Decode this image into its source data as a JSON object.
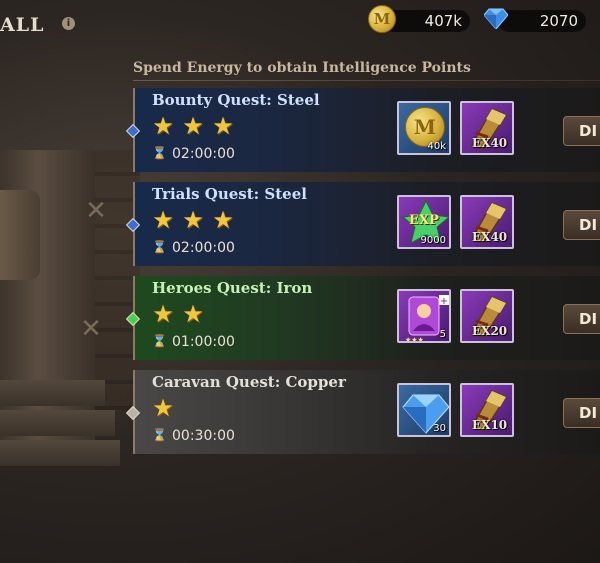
{
  "header": {
    "title": "ALL",
    "info_icon": "i",
    "resources": [
      {
        "name": "gold",
        "icon": "gold-coin-icon",
        "icon_glyph": "M",
        "value": "407k"
      },
      {
        "name": "gems",
        "icon": "blue-gem-icon",
        "value": "2070"
      }
    ]
  },
  "subtitle": "Spend Energy to obtain Intelligence Points",
  "quests": [
    {
      "name": "Bounty Quest: Steel",
      "stars": 3,
      "time": "02:00:00",
      "theme": "blue",
      "rewards": [
        {
          "icon": "gold-coin-icon",
          "glyph": "M",
          "count": "40k"
        },
        {
          "icon": "ex-scroll-icon",
          "label": "EX40"
        }
      ],
      "button": "DI"
    },
    {
      "name": "Trials Quest: Steel",
      "stars": 3,
      "time": "02:00:00",
      "theme": "blue",
      "rewards": [
        {
          "icon": "exp-crystal-icon",
          "glyph": "EXP",
          "count": "9000"
        },
        {
          "icon": "ex-scroll-icon",
          "label": "EX40"
        }
      ],
      "button": "DI"
    },
    {
      "name": "Heroes Quest: Iron",
      "stars": 2,
      "time": "01:00:00",
      "theme": "green",
      "rewards": [
        {
          "icon": "hero-shard-icon",
          "count": "5"
        },
        {
          "icon": "ex-scroll-icon",
          "label": "EX20"
        }
      ],
      "button": "DI"
    },
    {
      "name": "Caravan Quest: Copper",
      "stars": 1,
      "time": "00:30:00",
      "theme": "grey",
      "rewards": [
        {
          "icon": "blue-gem-icon",
          "count": "30"
        },
        {
          "icon": "ex-scroll-icon",
          "label": "EX10"
        }
      ],
      "button": "DI"
    }
  ],
  "colors": {
    "blue_name": "#cfe0ff",
    "green_name": "#c6f0b8",
    "grey_name": "#e4e0d8",
    "blue_diamond": "#3a6ed0",
    "green_diamond": "#4ad04a",
    "grey_diamond": "#b8b2a8"
  }
}
